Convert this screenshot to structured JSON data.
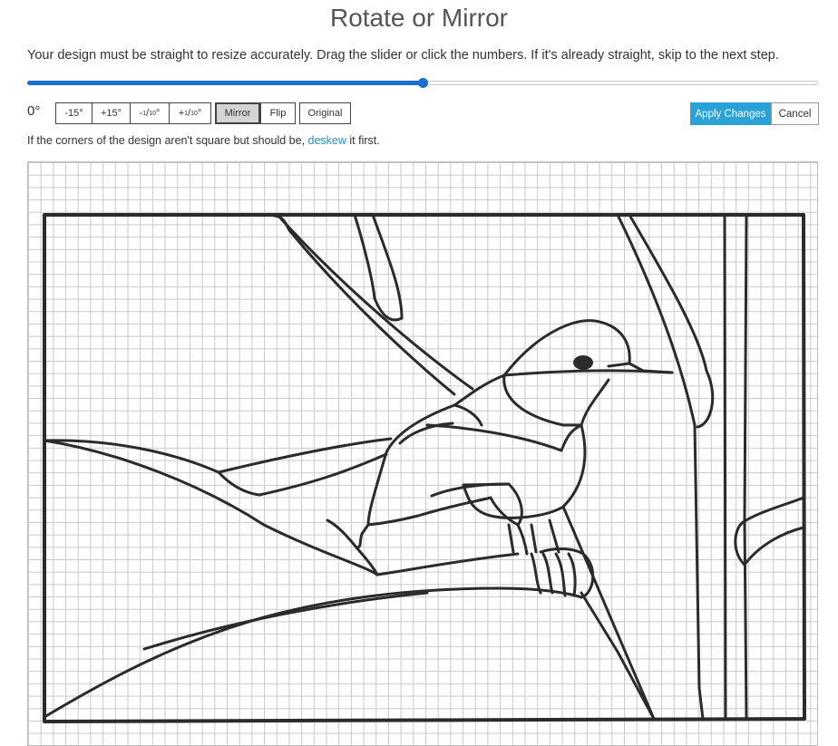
{
  "header": {
    "title": "Rotate or Mirror"
  },
  "instructions": "Your design must be straight to resize accurately. Drag the slider or click the numbers. If it's already straight, skip to the next step.",
  "slider": {
    "value_fraction": 0.5
  },
  "angle": {
    "value": "0°"
  },
  "buttons": {
    "minus15": "-15°",
    "plus15": "+15°",
    "minus_tenth": {
      "sign": "-",
      "num": "1",
      "den": "10",
      "deg": "°"
    },
    "plus_tenth": {
      "sign": "+",
      "num": "1",
      "den": "10",
      "deg": "°"
    },
    "mirror": "Mirror",
    "flip": "Flip",
    "original": "Original",
    "apply": "Apply Changes",
    "cancel": "Cancel"
  },
  "deskew": {
    "prefix": "If the corners of the design aren't square but should be, ",
    "link": "deskew",
    "suffix": " it first."
  },
  "colors": {
    "accent": "#1a6fd1",
    "apply_button": "#2aa2d8",
    "link": "#2a8cc4",
    "grid": "#c8c8c8",
    "line_art": "#2b2b2b"
  },
  "icons": {
    "design": "bird-on-branch-pattern"
  }
}
